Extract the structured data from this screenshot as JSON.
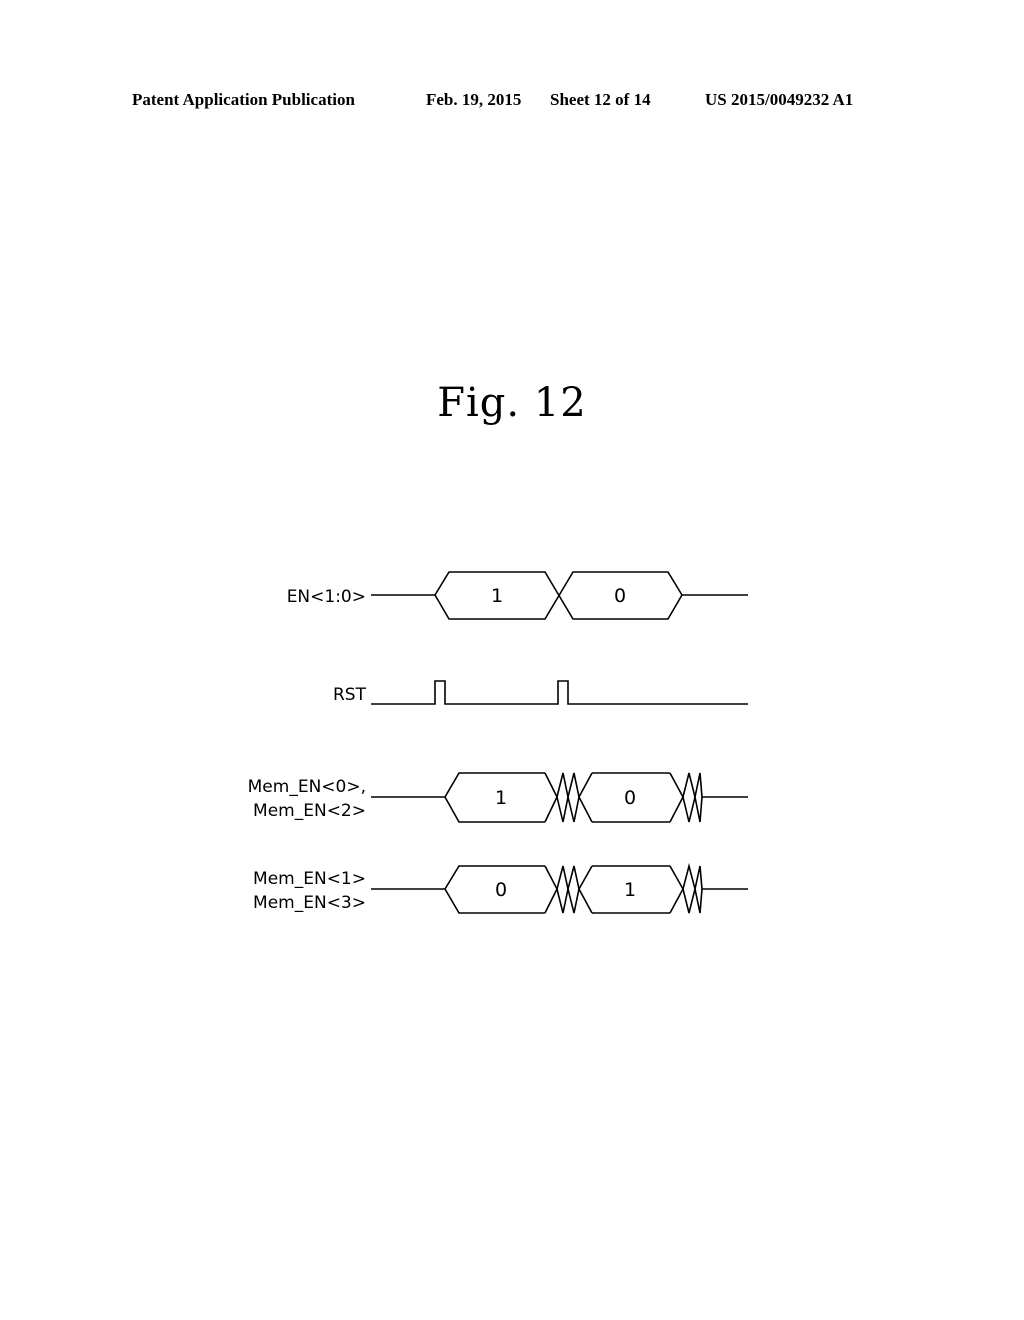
{
  "header": {
    "publication": "Patent Application Publication",
    "date": "Feb. 19, 2015",
    "sheet": "Sheet 12 of 14",
    "number": "US 2015/0049232 A1"
  },
  "figure": {
    "title": "Fig. 12"
  },
  "signals": [
    {
      "id": "en",
      "type": "bus",
      "label_lines": [
        "EN<1:0>"
      ],
      "values": [
        "1",
        "0"
      ],
      "transition": "cross"
    },
    {
      "id": "rst",
      "type": "pulse",
      "label_lines": [
        "RST"
      ],
      "pulse_count": 2
    },
    {
      "id": "mem02",
      "type": "bus",
      "label_lines": [
        "Mem_EN<0>,",
        "Mem_EN<2>"
      ],
      "values": [
        "1",
        "0"
      ],
      "transition": "multi-cross"
    },
    {
      "id": "mem13",
      "type": "bus",
      "label_lines": [
        "Mem_EN<1>",
        "Mem_EN<3>"
      ],
      "values": [
        "0",
        "1"
      ],
      "transition": "multi-cross"
    }
  ]
}
